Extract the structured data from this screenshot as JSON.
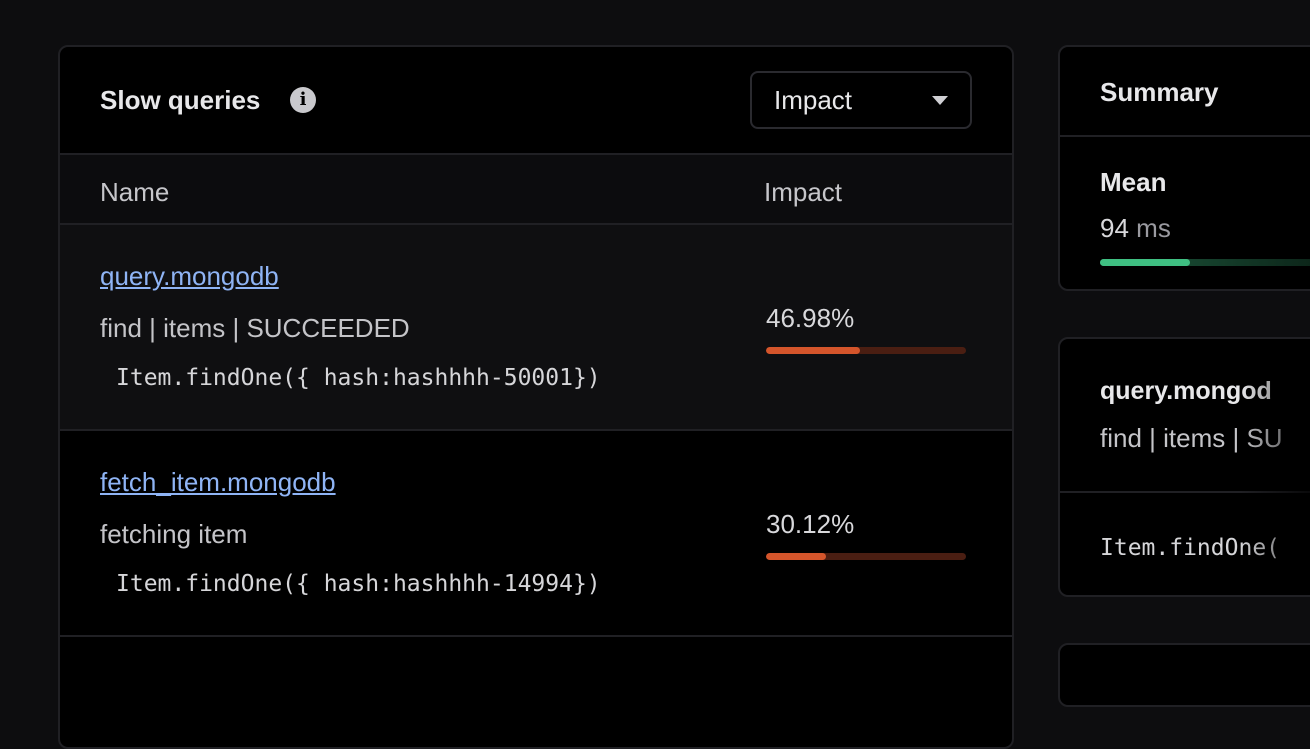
{
  "slow_queries": {
    "title": "Slow queries",
    "sort_select": {
      "value": "Impact"
    },
    "columns": {
      "name": "Name",
      "impact": "Impact"
    },
    "rows": [
      {
        "name": "query.mongodb",
        "description": "find | items | SUCCEEDED",
        "code": "Item.findOne({ hash:hashhhh-50001})",
        "impact": "46.98%",
        "impact_fraction": 0.4698
      },
      {
        "name": "fetch_item.mongodb",
        "description": "fetching item",
        "code": "Item.findOne({ hash:hashhhh-14994})",
        "impact": "30.12%",
        "impact_fraction": 0.3012
      }
    ]
  },
  "summary": {
    "title": "Summary",
    "mean_label": "Mean",
    "mean_value": "94",
    "mean_unit": "ms",
    "mean_fraction": 0.375
  },
  "detail": {
    "name": "query.mongod",
    "description": "find | items | SU",
    "code": "Item.findOne("
  },
  "colors": {
    "impact_bar": "#d4552b",
    "impact_track": "#4a1e12",
    "mean_bar": "#3fbf82",
    "link": "#8fb4f5"
  }
}
